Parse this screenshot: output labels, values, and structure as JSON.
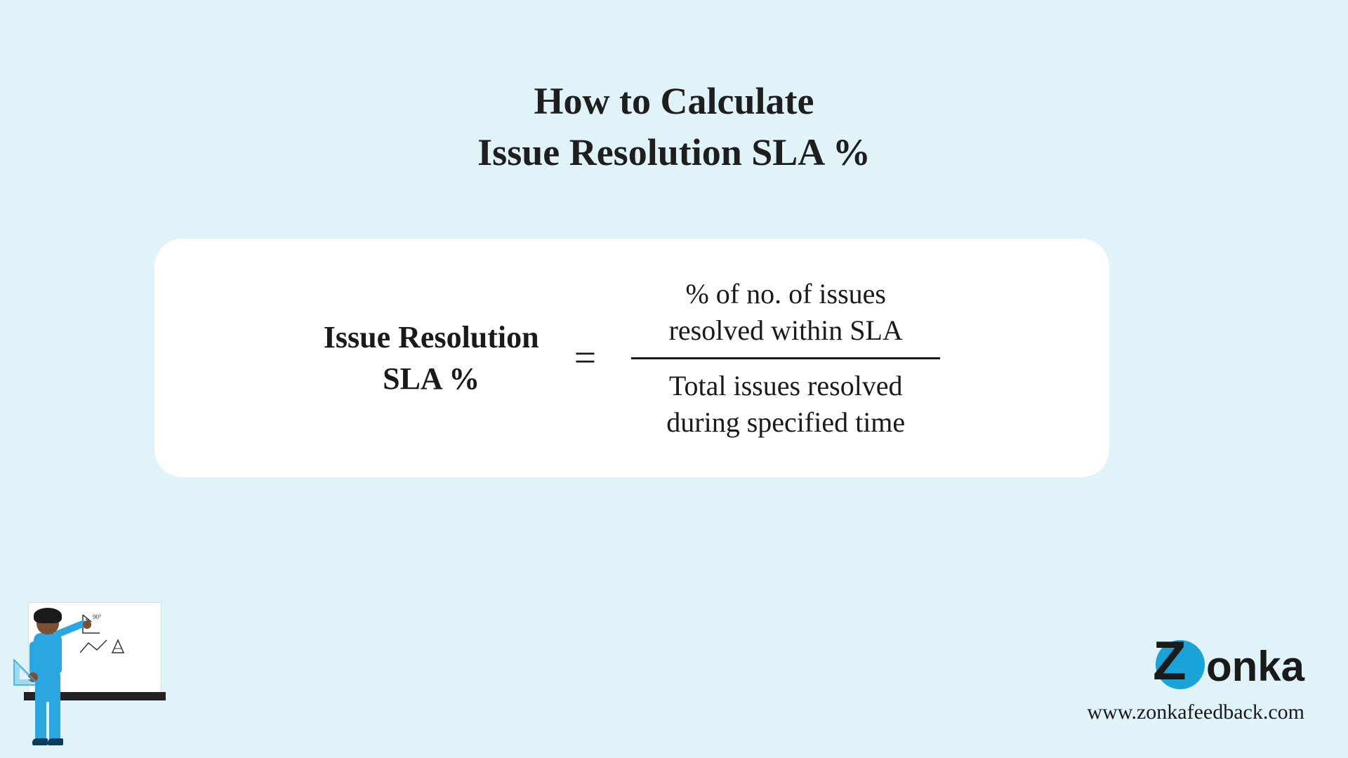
{
  "title_line1": "How to Calculate",
  "title_line2": "Issue Resolution SLA %",
  "formula": {
    "lhs_line1": "Issue Resolution",
    "lhs_line2": "SLA %",
    "equals": "=",
    "numerator_line1": "% of no. of issues",
    "numerator_line2": "resolved within SLA",
    "denominator_line1": "Total issues resolved",
    "denominator_line2": "during specified time"
  },
  "brand": {
    "logo_z": "Z",
    "logo_rest": "onka",
    "url": "www.zonkafeedback.com"
  },
  "illustration": {
    "angle_label": "90°"
  }
}
